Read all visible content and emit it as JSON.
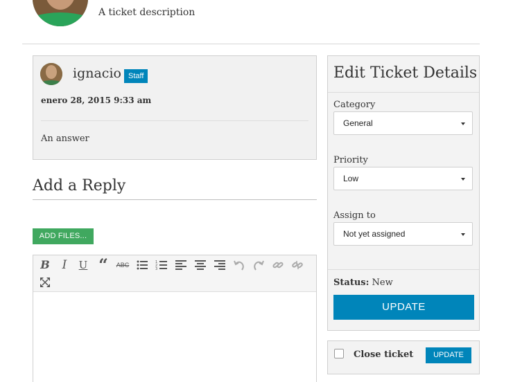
{
  "ticket": {
    "description": "A ticket description"
  },
  "reply": {
    "author": "ignacio",
    "badge": "Staff",
    "date": "enero 28, 2015 9:33 am",
    "body": "An answer"
  },
  "add_reply": {
    "title": "Add a Reply",
    "add_files_label": "ADD FILES..."
  },
  "editor": {
    "toolbar": [
      "bold-icon",
      "italic-icon",
      "underline-icon",
      "blockquote-icon",
      "strikethrough-icon",
      "bullet-list-icon",
      "numbered-list-icon",
      "align-left-icon",
      "align-center-icon",
      "align-right-icon",
      "undo-icon",
      "redo-icon",
      "link-icon",
      "unlink-icon",
      "fullscreen-icon"
    ]
  },
  "sidebar": {
    "title": "Edit Ticket Details",
    "category": {
      "label": "Category",
      "value": "General"
    },
    "priority": {
      "label": "Priority",
      "value": "Low"
    },
    "assign": {
      "label": "Assign to",
      "value": "Not yet assigned"
    },
    "status": {
      "label": "Status:",
      "value": "New"
    },
    "update_label": "UPDATE"
  },
  "close": {
    "label": "Close ticket",
    "update_label": "UPDATE"
  },
  "colors": {
    "primary": "#0085ba",
    "success": "#40a85f"
  }
}
